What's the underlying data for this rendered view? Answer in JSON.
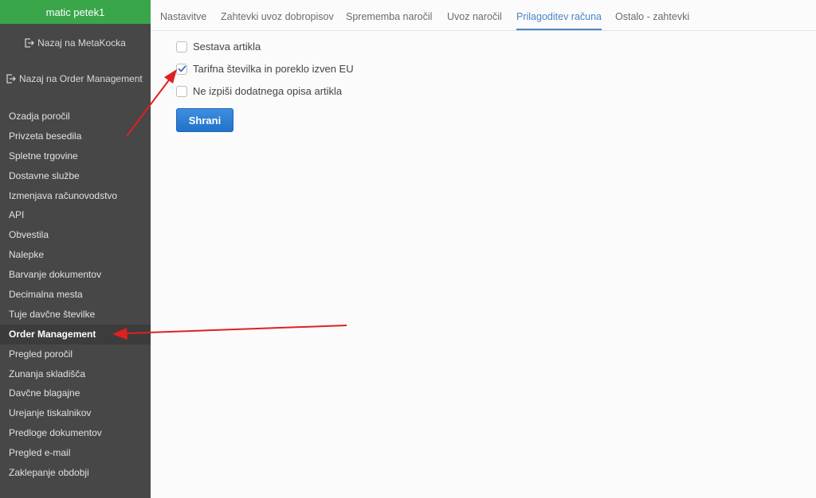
{
  "sidebar": {
    "user_name": "matic petek1",
    "back_links": [
      {
        "label": "Nazaj na MetaKocka",
        "icon": "exit-icon"
      },
      {
        "label": "Nazaj na Order Management",
        "icon": "exit-icon"
      }
    ],
    "items": [
      {
        "label": "Ozadja poročil"
      },
      {
        "label": "Privzeta besedila"
      },
      {
        "label": "Spletne trgovine"
      },
      {
        "label": "Dostavne službe"
      },
      {
        "label": "Izmenjava računovodstvo"
      },
      {
        "label": "API"
      },
      {
        "label": "Obvestila"
      },
      {
        "label": "Nalepke"
      },
      {
        "label": "Barvanje dokumentov"
      },
      {
        "label": "Decimalna mesta"
      },
      {
        "label": "Tuje davčne številke"
      },
      {
        "label": "Order Management"
      },
      {
        "label": "Pregled poročil"
      },
      {
        "label": "Zunanja skladišča"
      },
      {
        "label": "Davčne blagajne"
      },
      {
        "label": "Urejanje tiskalnikov"
      },
      {
        "label": "Predloge dokumentov"
      },
      {
        "label": "Pregled e-mail"
      },
      {
        "label": "Zaklepanje obdobji"
      }
    ],
    "active_item": "Order Management",
    "bg_color": "#474747",
    "header_color": "#3aa64a"
  },
  "tabs": [
    {
      "label": "Nastavitve"
    },
    {
      "label": "Zahtevki uvoz dobropisov"
    },
    {
      "label": "Sprememba naročil"
    },
    {
      "label": "Uvoz naročil"
    },
    {
      "label": "Prilagoditev računa"
    },
    {
      "label": "Ostalo - zahtevki"
    }
  ],
  "active_tab": "Prilagoditev računa",
  "accent_color": "#4a86c5",
  "options": [
    {
      "label": "Sestava artikla",
      "checked": false
    },
    {
      "label": "Tarifna številka in poreklo izven EU",
      "checked": true
    },
    {
      "label": "Ne izpiši dodatnega opisa artikla",
      "checked": false
    }
  ],
  "save_button": {
    "label": "Shrani",
    "color": "#2a7fd4"
  },
  "annotation_color": "#e02020"
}
